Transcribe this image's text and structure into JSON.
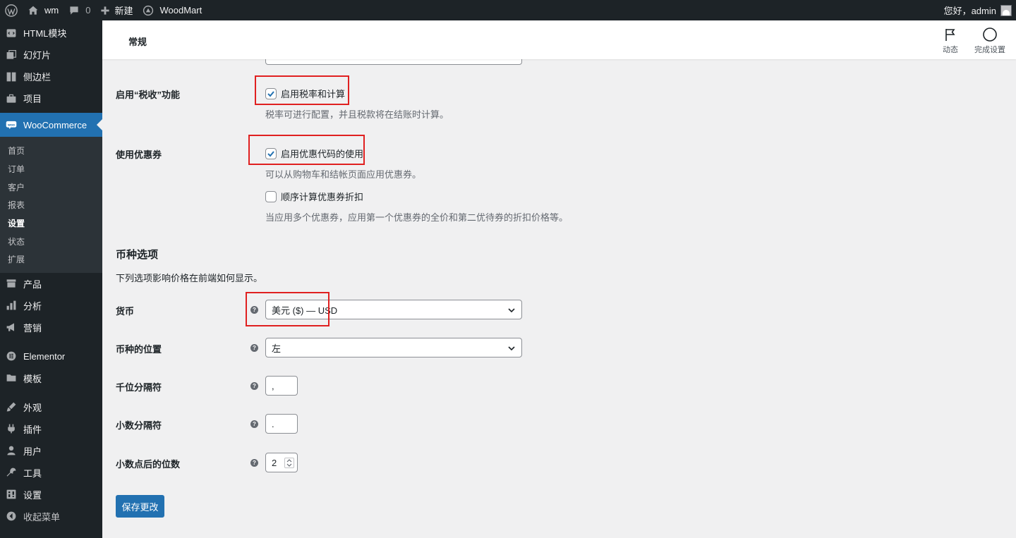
{
  "adminbar": {
    "site_name": "wm",
    "comments_count": "0",
    "new_label": "新建",
    "theme_label": "WoodMart",
    "greeting": "您好，admin"
  },
  "sidebar": {
    "items": [
      {
        "label": "HTML模块",
        "icon": "html-block-icon"
      },
      {
        "label": "幻灯片",
        "icon": "slides-icon"
      },
      {
        "label": "侧边栏",
        "icon": "sidebar-layout-icon"
      },
      {
        "label": "项目",
        "icon": "portfolio-briefcase-icon"
      },
      {
        "label": "WooCommerce",
        "icon": "woo-icon"
      },
      {
        "label": "产品",
        "icon": "products-archive-icon"
      },
      {
        "label": "分析",
        "icon": "analytics-bars-icon"
      },
      {
        "label": "营销",
        "icon": "megaphone-icon"
      },
      {
        "label": "Elementor",
        "icon": "elementor-icon"
      },
      {
        "label": "模板",
        "icon": "folder-icon"
      },
      {
        "label": "外观",
        "icon": "paintbrush-icon"
      },
      {
        "label": "插件",
        "icon": "plugin-icon"
      },
      {
        "label": "用户",
        "icon": "users-icon"
      },
      {
        "label": "工具",
        "icon": "wrench-icon"
      },
      {
        "label": "设置",
        "icon": "settings-icon"
      },
      {
        "label": "收起菜单",
        "icon": "collapse-icon"
      }
    ],
    "woo_submenu": [
      "首页",
      "订单",
      "客户",
      "报表",
      "设置",
      "状态",
      "扩展"
    ]
  },
  "header": {
    "title": "常规",
    "activity_label": "动态",
    "finish_setup_label": "完成设置"
  },
  "tax": {
    "label": "启用“税收”功能",
    "checkbox_label": "启用税率和计算",
    "checked": true,
    "description": "税率可进行配置，并且税款将在结账时计算。"
  },
  "coupons": {
    "label": "使用优惠券",
    "enable_label": "启用优惠代码的使用",
    "enable_checked": true,
    "enable_description": "可以从购物车和结帐页面应用优惠券。",
    "sequential_label": "顺序计算优惠券折扣",
    "sequential_checked": false,
    "sequential_description": "当应用多个优惠券，应用第一个优惠券的全价和第二优待券的折扣价格等。"
  },
  "currency_options": {
    "title": "币种选项",
    "description": "下列选项影响价格在前端如何显示。",
    "currency_label": "货币",
    "currency_value": "美元 ($) — USD",
    "position_label": "币种的位置",
    "position_value": "左",
    "thousand_sep_label": "千位分隔符",
    "thousand_sep_value": ",",
    "decimal_sep_label": "小数分隔符",
    "decimal_sep_value": ".",
    "decimals_label": "小数点后的位数",
    "decimals_value": "2"
  },
  "save_label": "保存更改",
  "colors": {
    "admin_dark": "#1d2327",
    "accent_blue": "#2271b1",
    "highlight_red": "#e02020"
  }
}
